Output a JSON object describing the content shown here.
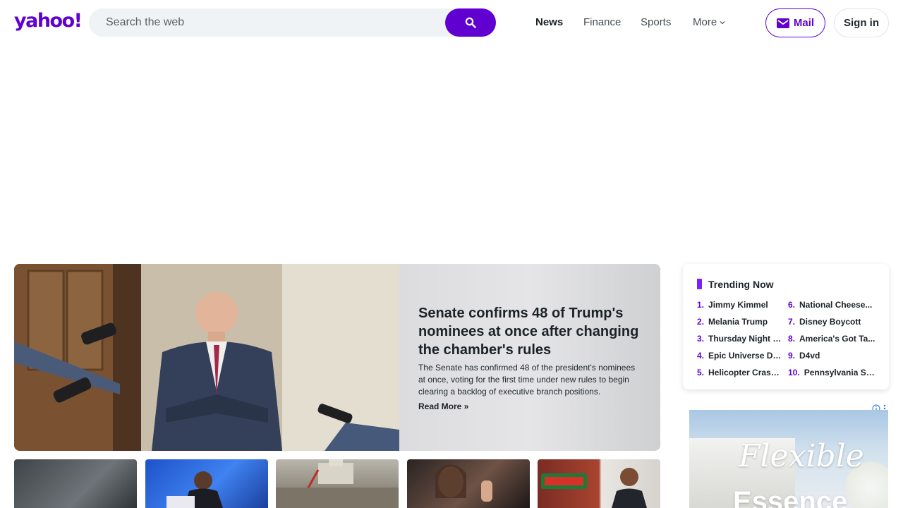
{
  "header": {
    "logo_text": "yahoo!",
    "search_placeholder": "Search the web",
    "nav": [
      {
        "label": "News"
      },
      {
        "label": "Finance"
      },
      {
        "label": "Sports"
      },
      {
        "label": "More"
      }
    ],
    "mail_label": "Mail",
    "signin_label": "Sign in"
  },
  "hero": {
    "title": "Senate confirms 48 of Trump's nominees at once after changing the chamber's rules",
    "summary": "The Senate has confirmed 48 of the president's nominees at once, voting for the first time under new rules to begin clearing a backlog of executive branch positions.",
    "read_more": "Read More »"
  },
  "trending": {
    "title": "Trending Now",
    "items": [
      {
        "num": "1.",
        "label": "Jimmy Kimmel"
      },
      {
        "num": "2.",
        "label": "Melania Trump"
      },
      {
        "num": "3.",
        "label": "Thursday Night F..."
      },
      {
        "num": "4.",
        "label": "Epic Universe De..."
      },
      {
        "num": "5.",
        "label": "Helicopter Crash ..."
      },
      {
        "num": "6.",
        "label": "National Cheese..."
      },
      {
        "num": "7.",
        "label": "Disney Boycott"
      },
      {
        "num": "8.",
        "label": "America's Got Ta..."
      },
      {
        "num": "9.",
        "label": "D4vd"
      },
      {
        "num": "10.",
        "label": "Pennsylvania Sh..."
      }
    ]
  },
  "ad": {
    "line1": "Flexible",
    "line2": "Essence"
  },
  "colors": {
    "brand": "#6001d2",
    "trending_accent": "#7e1fff"
  }
}
